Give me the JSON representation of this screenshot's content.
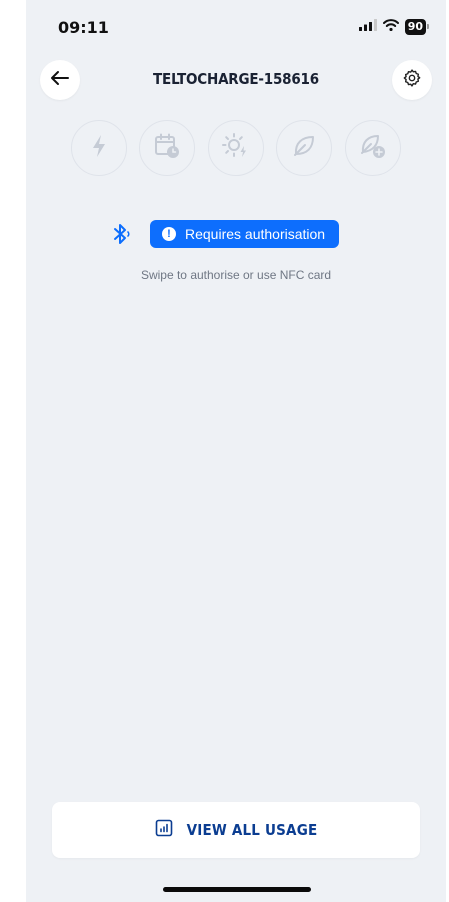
{
  "status_bar": {
    "time": "09:11",
    "battery": "90",
    "signal_icon": "signal-icon",
    "wifi_icon": "wifi-icon"
  },
  "header": {
    "title": "TELTOCHARGE-158616",
    "back_icon": "arrow-left-icon",
    "settings_icon": "gear-icon"
  },
  "charge_modes": [
    {
      "icon": "lightning-icon"
    },
    {
      "icon": "calendar-clock-icon"
    },
    {
      "icon": "sun-lightning-icon"
    },
    {
      "icon": "leaf-icon"
    },
    {
      "icon": "leaf-plus-icon"
    }
  ],
  "auth": {
    "bluetooth_icon": "bluetooth-icon",
    "badge_label": "Requires authorisation",
    "hint": "Swipe to authorise or use NFC card"
  },
  "footer": {
    "usage_label": "VIEW ALL USAGE",
    "usage_icon": "chart-icon"
  },
  "colors": {
    "accent": "#0d6efd",
    "title": "#1a2233",
    "usage_text": "#0b3d91",
    "background": "#eef1f5",
    "mode_icon": "#c5cbd5"
  }
}
